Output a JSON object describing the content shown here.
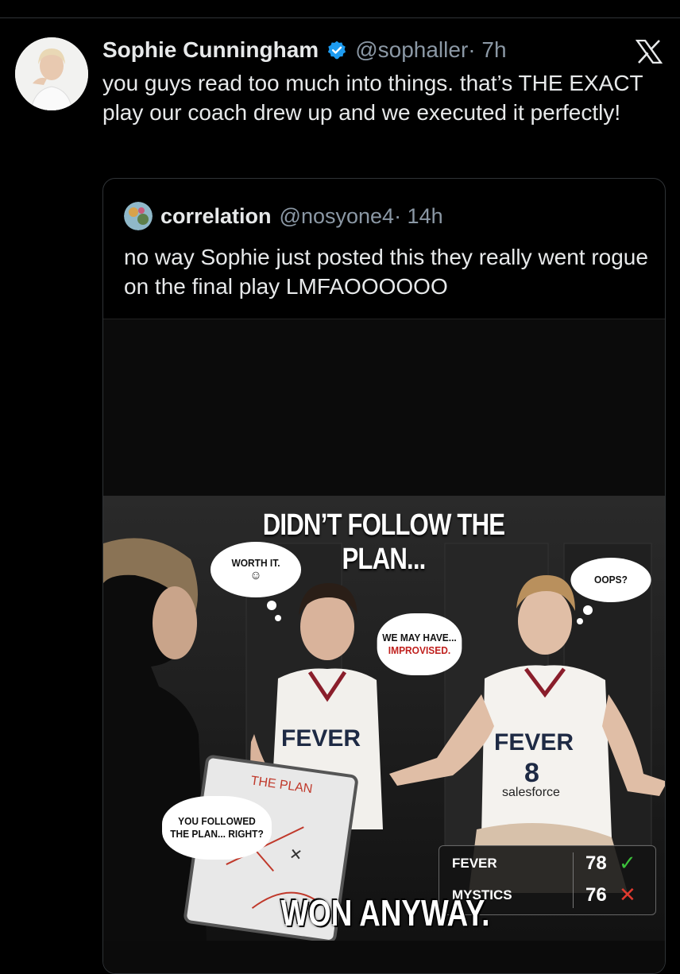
{
  "tweet": {
    "author_name": "Sophie Cunningham",
    "handle": "@sophaller",
    "time": "· 7h",
    "text": "you guys read too much into things. that’s THE EXACT play our coach drew up and we executed it perfectly!",
    "verified_color": "#1d9bf0"
  },
  "quoted_tweet": {
    "author_name": "correlation",
    "handle": "@nosyone4",
    "time": "· 14h",
    "text": "no way Sophie just posted this they really went rogue on the final play LMFAOOOOOO"
  },
  "meme": {
    "top_caption": "DIDN’T FOLLOW THE PLAN...",
    "bottom_caption": "WON ANYWAY.",
    "bubbles": {
      "worth_it": "WORTH IT.",
      "oops": "OOPS?",
      "we_may_have": "WE MAY HAVE...",
      "improvised": "IMPROVISED.",
      "you_followed": "YOU FOLLOWED",
      "the_plan_right": "THE PLAN... RIGHT?"
    },
    "whiteboard_label": "THE PLAN",
    "jersey_left": "FEVER",
    "jersey_right": "FEVER",
    "jersey_number": "8",
    "sponsor": "salesforce",
    "scoreboard": [
      {
        "team": "FEVER",
        "score": "78",
        "mark": "✓",
        "color": "#3cc13b"
      },
      {
        "team": "MYSTICS",
        "score": "76",
        "mark": "✕",
        "color": "#e03a2f"
      }
    ]
  },
  "icons": {
    "brand": "x-logo-icon",
    "verified": "verified-badge-icon"
  },
  "colors": {
    "background": "#000000",
    "text": "#e7e9ea",
    "secondary_text": "#8b98a5"
  }
}
